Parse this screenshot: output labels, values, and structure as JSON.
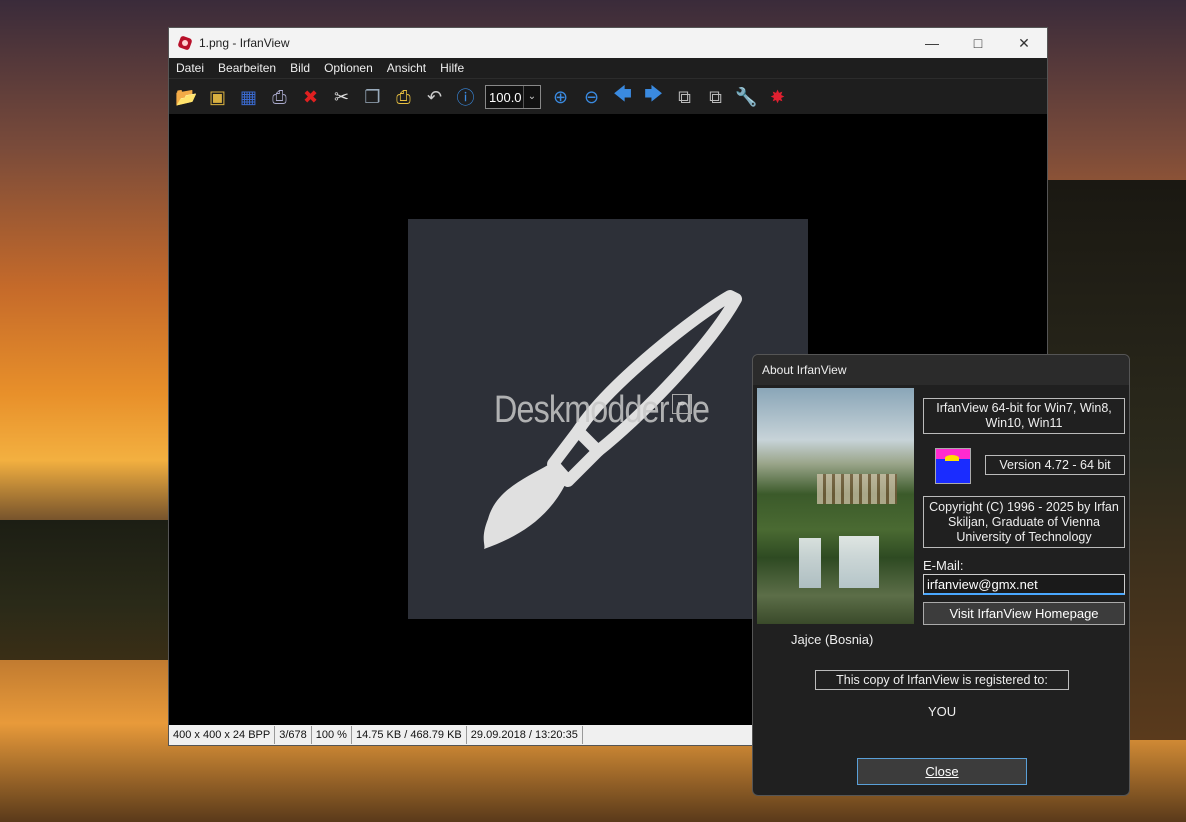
{
  "window": {
    "title": "1.png - IrfanView",
    "menu": [
      "Datei",
      "Bearbeiten",
      "Bild",
      "Optionen",
      "Ansicht",
      "Hilfe"
    ],
    "zoom_value": "100.0",
    "watermark": "Deskmodder.de",
    "status": [
      "400 x 400 x 24 BPP",
      "3/678",
      "100 %",
      "14.75 KB / 468.79 KB",
      "29.09.2018 / 13:20:35"
    ]
  },
  "toolbar_icons": [
    "open-folder-icon",
    "thumbnails-icon",
    "save-icon",
    "print-icon",
    "delete-icon",
    "cut-icon",
    "copy-icon",
    "paste-icon",
    "undo-icon",
    "info-icon",
    "zoom-in-icon",
    "zoom-out-icon",
    "previous-icon",
    "next-icon",
    "first-page-icon",
    "last-page-icon",
    "settings-icon",
    "exit-icon"
  ],
  "about": {
    "title": "About  IrfanView",
    "caption": "Jajce (Bosnia)",
    "product": "IrfanView 64-bit for Win7, Win8, Win10, Win11",
    "version": "Version 4.72 - 64 bit",
    "copyright": "Copyright (C) 1996 - 2025 by Irfan Skiljan, Graduate of Vienna University of Technology",
    "email_label": "E-Mail:",
    "email_value": "irfanview@gmx.net",
    "homepage_button": "Visit IrfanView Homepage",
    "registered_label": "This copy of IrfanView is registered to:",
    "registered_to": "YOU",
    "close_button": "Close"
  }
}
